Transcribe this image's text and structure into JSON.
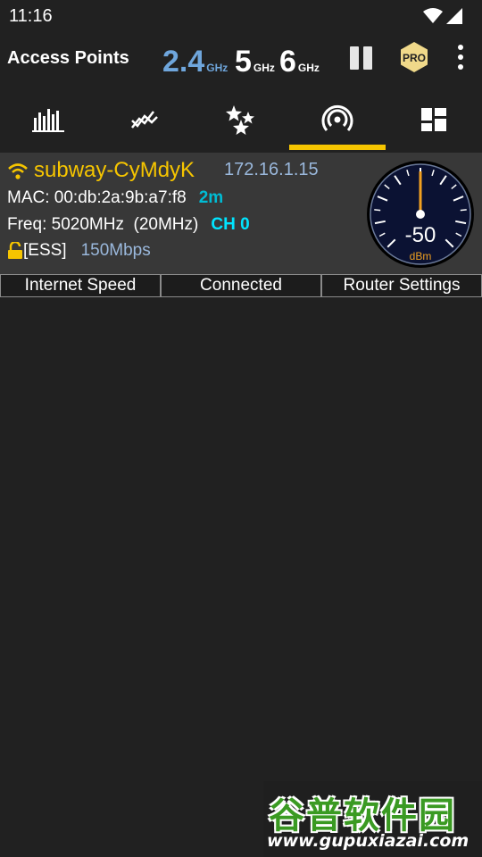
{
  "status_bar": {
    "time": "11:16"
  },
  "app_bar": {
    "title": "Access Points",
    "bands": [
      {
        "value": "2.4",
        "unit": "GHz",
        "color": "#6fa6dc",
        "active": true
      },
      {
        "value": "5",
        "unit": "GHz",
        "color": "#ffffff",
        "active": false
      },
      {
        "value": "6",
        "unit": "GHz",
        "color": "#ffffff",
        "active": false
      }
    ],
    "pro_label": "PRO",
    "icons": [
      "pause-icon",
      "pro-badge-icon",
      "more-vert-icon"
    ]
  },
  "tabs": [
    {
      "icon": "channel-graph-icon",
      "selected": false
    },
    {
      "icon": "time-graph-icon",
      "selected": false
    },
    {
      "icon": "channel-rating-icon",
      "selected": false
    },
    {
      "icon": "access-points-icon",
      "selected": true
    },
    {
      "icon": "dashboard-icon",
      "selected": false
    }
  ],
  "access_point": {
    "ssid": "subway-CyMdyK",
    "ip": "172.16.1.15",
    "mac_text": "MAC: 00:db:2a:9b:a7:f8",
    "distance": "2m",
    "freq_text": "Freq: 5020MHz  (20MHz)",
    "channel": "CH 0",
    "security": "[ESS]",
    "rate": "150Mbps",
    "signal": {
      "value": "-50",
      "unit": "dBm"
    }
  },
  "actions": [
    "Internet Speed",
    "Connected",
    "Router Settings"
  ],
  "watermark": {
    "cn": "谷普软件园",
    "url": "www.gupuxiazai.com"
  },
  "colors": {
    "accent": "#f6c500",
    "ssid": "#f6c500",
    "band_active": "#6fa6dc",
    "channel": "#00e5ff"
  }
}
